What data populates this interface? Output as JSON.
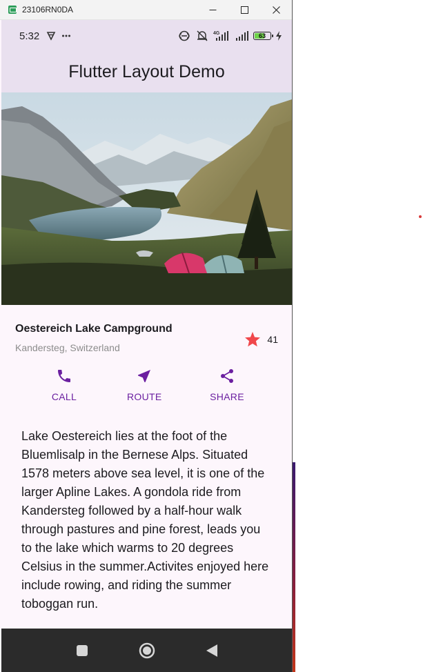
{
  "window": {
    "title": "23106RN0DA"
  },
  "status_bar": {
    "time": "5:32",
    "battery": "63",
    "icons": [
      "vpn-shield-icon",
      "more-dots-icon",
      "link-icon",
      "mute-icon",
      "signal-4g-icon",
      "signal-icon",
      "battery-icon",
      "charging-icon"
    ]
  },
  "app_bar": {
    "title": "Flutter Layout Demo"
  },
  "place": {
    "name": "Oestereich Lake Campground",
    "location": "Kandersteg, Switzerland",
    "favorite_count": "41"
  },
  "actions": [
    {
      "label": "CALL",
      "icon": "phone-icon"
    },
    {
      "label": "ROUTE",
      "icon": "navigation-arrow-icon"
    },
    {
      "label": "SHARE",
      "icon": "share-icon"
    }
  ],
  "description": "Lake Oestereich lies at the foot of the Bluemlisalp in the Bernese Alps. Situated 1578 meters above sea level, it is one of the larger Apline Lakes. A gondola ride from Kandersteg followed by a half-hour walk through pastures and pine forest, leads you to the lake which warms to 20 degrees Celsius in the summer.Activites enjoyed here include rowing, and riding the summer toboggan run.",
  "colors": {
    "accent": "#6b1fa0",
    "app_bar_bg": "#e9e0ef",
    "star": "#f0474b"
  }
}
